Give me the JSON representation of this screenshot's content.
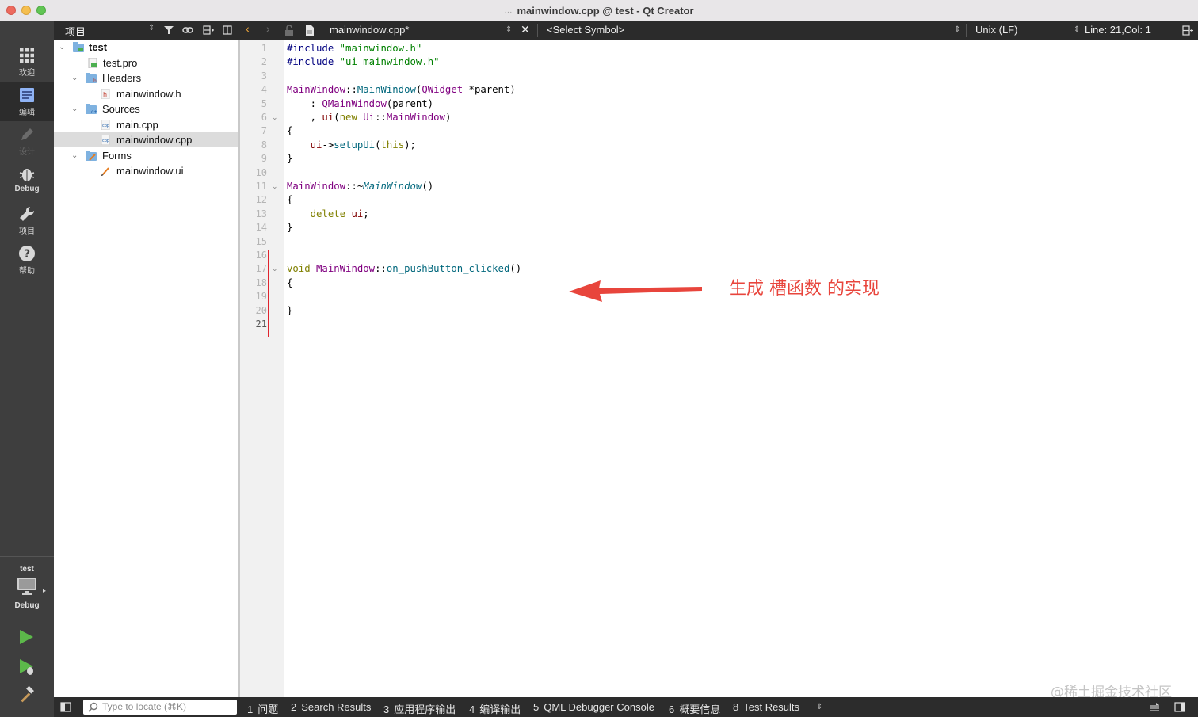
{
  "window": {
    "title": "mainwindow.cpp @ test - Qt Creator",
    "title_dots": "···"
  },
  "modes": [
    {
      "label": "欢迎",
      "icon": "grid-icon"
    },
    {
      "label": "编辑",
      "icon": "edit-doc-icon"
    },
    {
      "label": "设计",
      "icon": "pen-icon"
    },
    {
      "label": "Debug",
      "icon": "bug-icon"
    },
    {
      "label": "项目",
      "icon": "wrench-icon"
    },
    {
      "label": "帮助",
      "icon": "help-icon"
    }
  ],
  "kit": {
    "project": "test",
    "build": "Debug"
  },
  "project_pane": {
    "title": "项目",
    "tree": [
      {
        "label": "test",
        "icon": "project-icon"
      },
      {
        "label": "test.pro",
        "icon": "pro-file-icon"
      },
      {
        "label": "Headers",
        "icon": "headers-folder-icon"
      },
      {
        "label": "mainwindow.h",
        "icon": "header-file-icon"
      },
      {
        "label": "Sources",
        "icon": "sources-folder-icon"
      },
      {
        "label": "main.cpp",
        "icon": "cpp-file-icon"
      },
      {
        "label": "mainwindow.cpp",
        "icon": "cpp-file-icon"
      },
      {
        "label": "Forms",
        "icon": "forms-folder-icon"
      },
      {
        "label": "mainwindow.ui",
        "icon": "ui-file-icon"
      }
    ]
  },
  "editor_toolbar": {
    "file": "mainwindow.cpp*",
    "symbol": "<Select Symbol>",
    "line_ending": "Unix (LF)",
    "position": "Line: 21,Col: 1"
  },
  "editor": {
    "line_numbers": [
      "1",
      "2",
      "3",
      "4",
      "5",
      "6",
      "7",
      "8",
      "9",
      "10",
      "11",
      "12",
      "13",
      "14",
      "15",
      "16",
      "17",
      "18",
      "19",
      "20",
      "21"
    ],
    "current_line": 21
  },
  "annotation": {
    "text": "生成 槽函数 的实现",
    "color": "#e8453c"
  },
  "watermark": "@稀土掘金技术社区",
  "statusbar": {
    "locate_placeholder": "Type to locate (⌘K)",
    "tabs": [
      {
        "num": "1",
        "label": "问题"
      },
      {
        "num": "2",
        "label": "Search Results"
      },
      {
        "num": "3",
        "label": "应用程序输出"
      },
      {
        "num": "4",
        "label": "编译输出"
      },
      {
        "num": "5",
        "label": "QML Debugger Console"
      },
      {
        "num": "6",
        "label": "概要信息"
      },
      {
        "num": "8",
        "label": "Test Results"
      }
    ]
  }
}
